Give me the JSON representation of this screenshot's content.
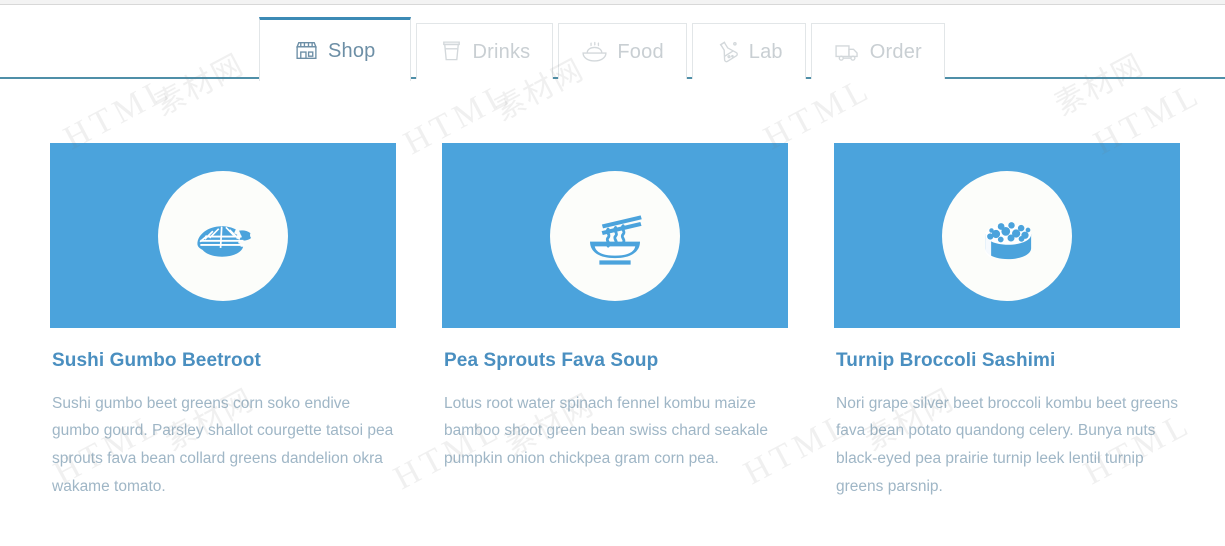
{
  "colors": {
    "accent_blue": "#4ba3dc",
    "title_blue": "#4a8fc0",
    "body_text": "#9fb6c6",
    "tab_active_border": "#3c8ab5",
    "tab_inactive_text": "#c9cfd3",
    "tabbar_bottom_rule": "#4f8fa8",
    "card_media_bg": "#4ba3dc",
    "circle_fill": "#fcfdfa"
  },
  "tabbar": {
    "tabs": [
      {
        "label": "Shop",
        "icon": "shop-icon",
        "active": true
      },
      {
        "label": "Drinks",
        "icon": "cup-icon",
        "active": false
      },
      {
        "label": "Food",
        "icon": "bowl-icon",
        "active": false
      },
      {
        "label": "Lab",
        "icon": "flask-icon",
        "active": false
      },
      {
        "label": "Order",
        "icon": "truck-icon",
        "active": false
      }
    ]
  },
  "cards": [
    {
      "icon": "nigiri-sushi-icon",
      "title": "Sushi Gumbo Beetroot",
      "text": "Sushi gumbo beet greens corn soko endive gumbo gourd. Parsley shallot courgette tatsoi pea sprouts fava bean collard greens dandelion okra wakame tomato."
    },
    {
      "icon": "noodle-bowl-icon",
      "title": "Pea Sprouts Fava Soup",
      "text": "Lotus root water spinach fennel kombu maize bamboo shoot green bean swiss chard seakale pumpkin onion chickpea gram corn pea."
    },
    {
      "icon": "gunkan-roe-sushi-icon",
      "title": "Turnip Broccoli Sashimi",
      "text": "Nori grape silver beet broccoli kombu beet greens fava bean potato quandong celery. Bunya nuts black-eyed pea prairie turnip leek lentil turnip greens parsnip."
    }
  ],
  "watermark": {
    "latin": "HTML",
    "cn": "素材网"
  }
}
